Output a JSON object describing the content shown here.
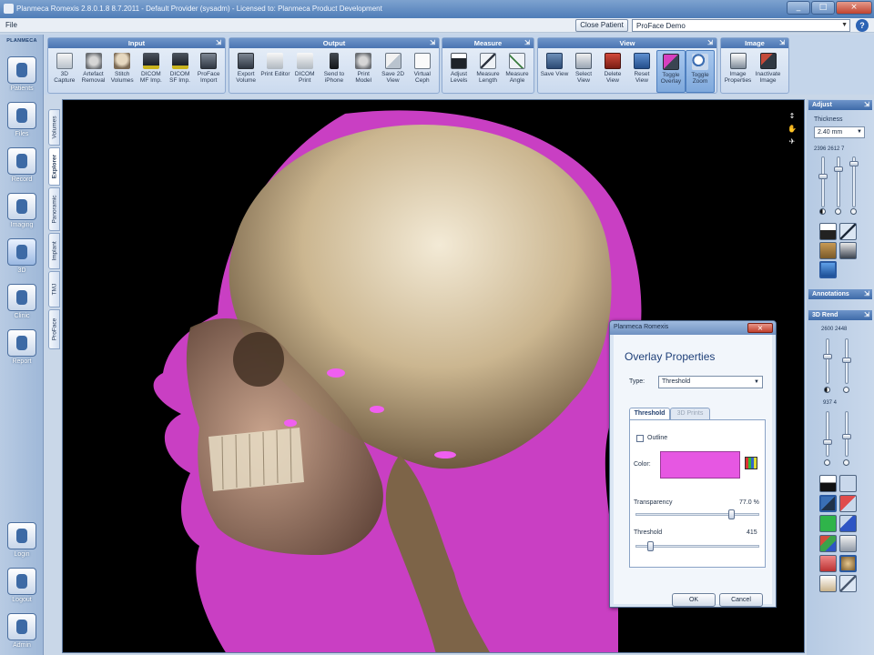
{
  "window": {
    "title": "Planmeca Romexis 2.8.0.1.8   8.7.2011 - Default Provider (sysadm) - Licensed to: Planmeca Product Development",
    "controls": [
      "_",
      "□",
      "×"
    ]
  },
  "menu": {
    "file": "File"
  },
  "header": {
    "close_patient": "Close Patient",
    "patient_name": "ProFace Demo",
    "help": "?"
  },
  "ribbon": {
    "groups": [
      {
        "title": "Input",
        "tools": [
          {
            "label": "3D Capture",
            "icon": "camera-icon"
          },
          {
            "label": "Artefact Removal",
            "icon": "artefact-removal-icon"
          },
          {
            "label": "Stitch Volumes",
            "icon": "stitch-volumes-icon"
          },
          {
            "label": "DICOM MF Imp.",
            "icon": "dicom-mf-import-icon"
          },
          {
            "label": "DICOM SF Imp.",
            "icon": "dicom-sf-import-icon"
          },
          {
            "label": "ProFace Import",
            "icon": "proface-import-icon"
          }
        ]
      },
      {
        "title": "Output",
        "tools": [
          {
            "label": "Export Volume",
            "icon": "export-volume-icon"
          },
          {
            "label": "Print Editor",
            "icon": "print-editor-icon"
          },
          {
            "label": "DICOM Print",
            "icon": "dicom-print-icon"
          },
          {
            "label": "Send to iPhone",
            "icon": "phone-icon"
          },
          {
            "label": "Print Model",
            "icon": "print-model-icon"
          },
          {
            "label": "Save 2D View",
            "icon": "save-2d-view-icon"
          },
          {
            "label": "Virtual Ceph",
            "icon": "virtual-ceph-icon"
          }
        ]
      },
      {
        "title": "Measure",
        "tools": [
          {
            "label": "Adjust Levels",
            "icon": "adjust-levels-icon"
          },
          {
            "label": "Measure Length",
            "icon": "measure-length-icon"
          },
          {
            "label": "Measure Angle",
            "icon": "measure-angle-icon"
          }
        ]
      },
      {
        "title": "View",
        "tools": [
          {
            "label": "Save View",
            "icon": "save-view-icon"
          },
          {
            "label": "Select View",
            "icon": "select-view-icon"
          },
          {
            "label": "Delete View",
            "icon": "delete-view-icon"
          },
          {
            "label": "Reset View",
            "icon": "reset-view-icon"
          },
          {
            "label": "Toggle Overlay",
            "icon": "toggle-overlay-icon"
          },
          {
            "label": "Toggle Zoom",
            "icon": "zoom-icon"
          }
        ]
      },
      {
        "title": "Image",
        "tools": [
          {
            "label": "Image Properties",
            "icon": "image-properties-icon"
          },
          {
            "label": "Inactivate Image",
            "icon": "inactivate-image-icon"
          }
        ]
      }
    ]
  },
  "sidebar": {
    "brand": "PLANMECA",
    "items": [
      {
        "label": "Patients",
        "icon": "patients-icon"
      },
      {
        "label": "Files",
        "icon": "files-icon"
      },
      {
        "label": "Record",
        "icon": "tooth-icon"
      },
      {
        "label": "Imaging",
        "icon": "imaging-icon"
      },
      {
        "label": "3D",
        "icon": "3d-icon"
      },
      {
        "label": "Clinic",
        "icon": "clinic-chair-icon"
      },
      {
        "label": "Report",
        "icon": "report-icon"
      },
      {
        "label": "Login",
        "icon": "login-arrow-icon"
      },
      {
        "label": "Logout",
        "icon": "logout-arrow-icon"
      },
      {
        "label": "Admin",
        "icon": "admin-icon"
      }
    ]
  },
  "view_tabs": [
    "Volumes",
    "Explorer",
    "Panoramic",
    "Implant",
    "TMJ",
    "ProFace"
  ],
  "active_view_tab": "Explorer",
  "viewport_tools": [
    "↕",
    "✋",
    "✈"
  ],
  "right_panel": {
    "adjust_title": "Adjust",
    "thickness_label": "Thickness",
    "thickness_value": "2.40 mm",
    "slider_values": "2396 2612  7",
    "annotations_title": "Annotations",
    "render_title": "3D Rend",
    "render_values_top": "2600  2448",
    "render_values_mid": "937      4"
  },
  "dialog": {
    "window_title": "Planmeca Romexis",
    "heading": "Overlay Properties",
    "type_label": "Type:",
    "type_value": "Threshold",
    "tabs": [
      "Threshold",
      "3D Prints"
    ],
    "outline_label": "Outline",
    "color_label": "Color:",
    "color_value": "#e657e2",
    "transparency_label": "Transparency",
    "transparency_value": "77.0 %",
    "transparency_fraction": 0.77,
    "threshold_label": "Threshold",
    "threshold_value": "415",
    "threshold_fraction": 0.12,
    "ok": "OK",
    "cancel": "Cancel"
  },
  "colors": {
    "overlay_magenta": "#d63fd0",
    "ribbon_title": "#4a75b2",
    "viewport_bg": "#000000"
  }
}
